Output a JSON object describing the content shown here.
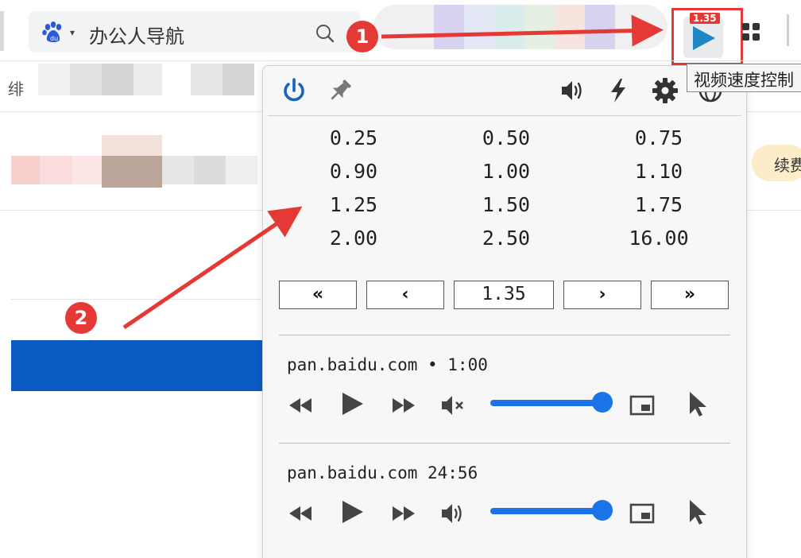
{
  "omnibox": {
    "search_engine": "baidu-paw-logo",
    "text": "办公人导航"
  },
  "extension": {
    "badge": "1.35",
    "tooltip": "视频速度控制"
  },
  "background_page": {
    "fragment_left": "绯",
    "pill_label": "续费"
  },
  "popup": {
    "toolbar_icons": [
      "power-icon",
      "pin-icon",
      "volume-icon",
      "lightning-icon",
      "gear-icon",
      "globe-icon"
    ],
    "speed_presets": [
      "0.25",
      "0.50",
      "0.75",
      "0.90",
      "1.00",
      "1.10",
      "1.25",
      "1.50",
      "1.75",
      "2.00",
      "2.50",
      "16.00"
    ],
    "current_speed": "1.35",
    "step_buttons": {
      "fast_decrease": "«",
      "decrease": "‹",
      "increase": "›",
      "fast_increase": "»"
    },
    "videos": [
      {
        "title": "pan.baidu.com • 1:00",
        "muted": true,
        "volume": 1.0
      },
      {
        "title": "pan.baidu.com 24:56",
        "muted": false,
        "volume": 1.0
      }
    ]
  },
  "annotations": {
    "step1": "1",
    "step2": "2",
    "arrow_color": "#e53935"
  },
  "colors": {
    "accent_blue": "#1a73e8",
    "power_blue": "#1565c0",
    "highlight_red": "#e53935",
    "play_teal": "#1e88c7"
  }
}
